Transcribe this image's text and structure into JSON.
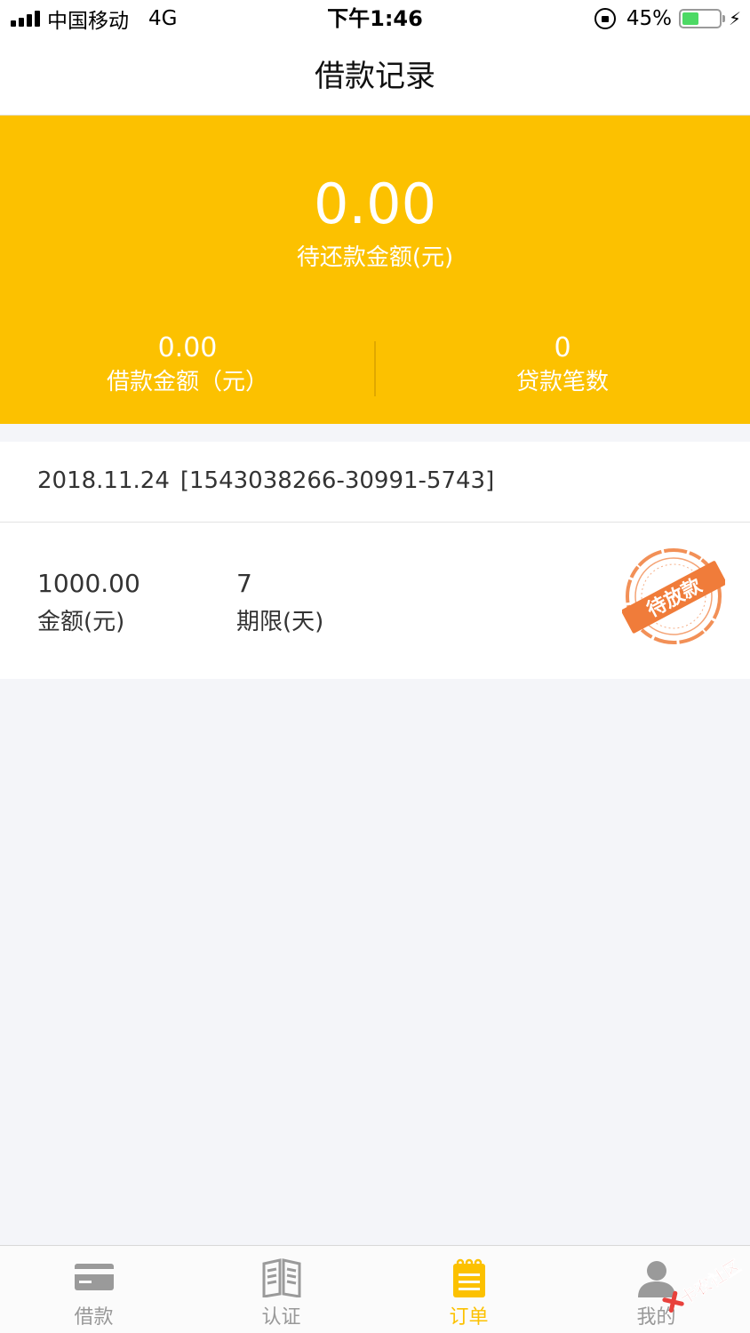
{
  "status_bar": {
    "carrier": "中国移动",
    "network": "4G",
    "time": "下午1:46",
    "battery_percent": "45%",
    "battery_level": 0.45,
    "battery_color": "#4cd964"
  },
  "header": {
    "title": "借款记录"
  },
  "summary": {
    "pending_amount": "0.00",
    "pending_label": "待还款金额(元)",
    "loan_amount": "0.00",
    "loan_amount_label": "借款金额（元）",
    "loan_count": "0",
    "loan_count_label": "贷款笔数",
    "background_color": "#fcc100"
  },
  "order": {
    "date": "2018.11.24",
    "id": "[1543038266-30991-5743]",
    "amount": "1000.00",
    "amount_label": "金额(元)",
    "term": "7",
    "term_label": "期限(天)",
    "status_stamp": "待放款",
    "stamp_color": "#f07c3a"
  },
  "tab_bar": {
    "accent_color": "#fcc100",
    "items": [
      {
        "label": "借款",
        "icon": "card-icon",
        "active": false
      },
      {
        "label": "认证",
        "icon": "book-icon",
        "active": false
      },
      {
        "label": "订单",
        "icon": "notepad-icon",
        "active": true
      },
      {
        "label": "我的",
        "icon": "user-icon",
        "active": false
      }
    ]
  },
  "watermark": {
    "text": "卡农社区"
  }
}
